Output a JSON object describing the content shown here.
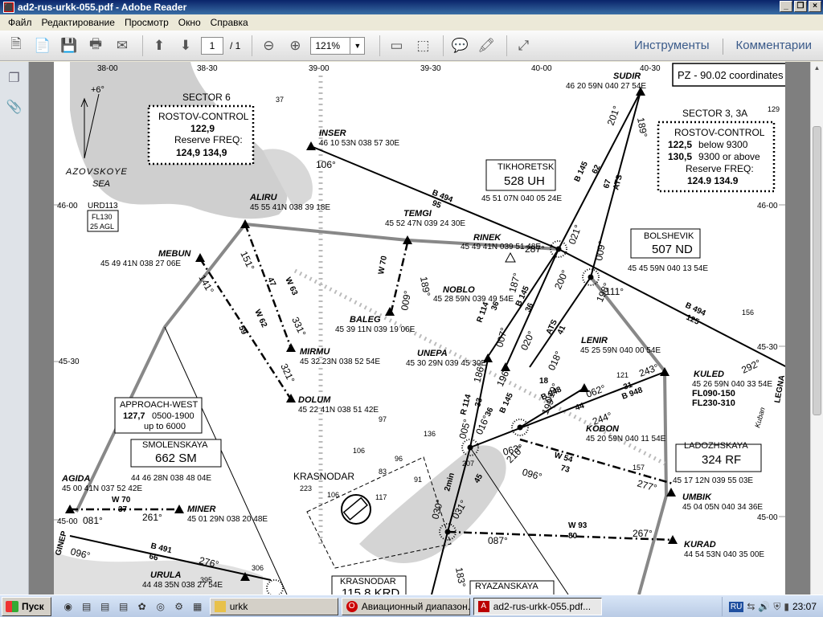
{
  "window": {
    "title": "ad2-rus-urkk-055.pdf - Adobe Reader",
    "app_icon": "pdf-icon"
  },
  "menu": [
    "Файл",
    "Редактирование",
    "Просмотр",
    "Окно",
    "Справка"
  ],
  "toolbar": {
    "page_current": "1",
    "page_total": "/ 1",
    "zoom": "121%",
    "tools_link": "Инструменты",
    "comments_link": "Комментарии"
  },
  "chart": {
    "header_box": "PZ - 90.02 coordinates",
    "sector6": {
      "title": "SECTOR 6",
      "unit": "ROSTOV-CONTROL",
      "freq": "122,9",
      "reserve": "Reserve FREQ:",
      "reserve_freqs": "124,9 134,9"
    },
    "sector3": {
      "title": "SECTOR 3, 3A",
      "unit": "ROSTOV-CONTROL",
      "freq1": "122,5",
      "freq1_note": "below 9300",
      "freq2": "130,5",
      "freq2_note": "9300 or above",
      "reserve": "Reserve FREQ:",
      "reserve_freqs": "124.9 134.9"
    },
    "sea_label_1": "AZOVSKOYE",
    "sea_label_2": "SEA",
    "variation": "+6°",
    "city": "KRASNODAR",
    "lat_labels": [
      "46-00",
      "45-30",
      "45-00",
      "46-00",
      "45-30",
      "45-00"
    ],
    "lon_labels": [
      "38-00",
      "38-30",
      "39-00",
      "39-30",
      "40-00",
      "40-30"
    ],
    "urd": "URD113",
    "urd_limits_1": "FL130",
    "urd_limits_2": "25 AGL",
    "points": [
      {
        "name": "SUDIR",
        "coords": "46 20 59N  040 27 54E"
      },
      {
        "name": "INSER",
        "coords": "46 10 53N  038 57 30E"
      },
      {
        "name": "ALIRU",
        "coords": "45 55 41N 038 39 18E"
      },
      {
        "name": "TEMGI",
        "coords": "45 52 47N 039 24 30E"
      },
      {
        "name": "MEBUN",
        "coords": "45 49 41N 038 27 06E"
      },
      {
        "name": "RINEK",
        "coords": "45 49 41N 039 51 48E"
      },
      {
        "name": "NOBLO",
        "coords": "45 28 59N 039 49 54E"
      },
      {
        "name": "BALEG",
        "coords": "45 39 11N 039 19 06E"
      },
      {
        "name": "MIRMU",
        "coords": "45 32 23N 038 52 54E"
      },
      {
        "name": "UNEPA",
        "coords": "45 30 29N 039 45 30E"
      },
      {
        "name": "LENIR",
        "coords": "45 25 59N 040 00 54E"
      },
      {
        "name": "KULED",
        "coords": "45 26 59N 040 33 54E"
      },
      {
        "name": "DOLUM",
        "coords": "45 22 41N 038 51 42E"
      },
      {
        "name": "KOBON",
        "coords": "45 20 59N 040 11 54E"
      },
      {
        "name": "AGIDA",
        "coords": "45 00 41N 037 52 42E"
      },
      {
        "name": "MINER",
        "coords": "45 01 29N 038 20 48E"
      },
      {
        "name": "UMBIK",
        "coords": "45 04 05N 040 34 36E"
      },
      {
        "name": "KURAD",
        "coords": "44 54 53N 040 35 00E"
      },
      {
        "name": "URULA",
        "coords": "44 48 35N 038 27 54E"
      }
    ],
    "navaids": [
      {
        "name": "TIKHORETSK",
        "ident": "528 UH",
        "coords": "45 51 07N 040 05 24E"
      },
      {
        "name": "BOLSHEVIK",
        "ident": "507 ND",
        "coords": "45 45 59N 040 13 54E"
      },
      {
        "name": "SMOLENSKAYA",
        "ident": "662 SM",
        "coords": "44 46 28N 038 48 04E"
      },
      {
        "name": "LADOZHSKAYA",
        "ident": "324 RF",
        "coords": "45 17 12N 039 55 03E"
      },
      {
        "name": "KRASNODAR",
        "ident": "115.8 KRD"
      },
      {
        "name": "RYAZANSKAYA",
        "ident": ""
      }
    ],
    "approach_west": {
      "title": "APPROACH-WEST",
      "freq": "127,7",
      "hours": "0500-1900",
      "limit": "up to 6000"
    },
    "kuled_levels": [
      "FL090-150",
      "FL230-310"
    ],
    "routes": {
      "b494": "B 494",
      "b494_dist": "95",
      "b494_2": "B 494",
      "b494_2_dist": "125",
      "w70": "W 70",
      "w63": "W 63",
      "w63_dist": "47",
      "w62": "W 62",
      "w62_dist": "59",
      "b145a": "B 145",
      "b145a_dist": "62",
      "ats1": "ATS",
      "ats1_dist": "67",
      "b145b": "B 145",
      "b145b_dist": "36",
      "r114a": "R 114",
      "r114a_dist": "36",
      "ats2": "ATS",
      "ats2_dist": "41",
      "b948": "B 948",
      "b948_dist": "31",
      "b948_2": "B 948",
      "b948_2_dist": "44",
      "w54": "W 54",
      "w54_dist": "73",
      "w93": "W 93",
      "w93_dist": "80",
      "w70b": "W 70",
      "w70b_dist": "37",
      "b491": "B 491",
      "b491_dist": "66",
      "r114b": "R 114",
      "r114b_dist": "33",
      "b145c": "B 145",
      "b145c_dist": "36",
      "d45": "45",
      "d18": "18",
      "d2min": "2min",
      "legna": "LEGNA",
      "ginep": "GINEP"
    },
    "bearings": [
      "106°",
      "201°",
      "189°",
      "021°",
      "287°",
      "009°",
      "111°",
      "292°",
      "151°",
      "331°",
      "141°",
      "321°",
      "009°",
      "189°",
      "187°",
      "007°",
      "200°",
      "198°",
      "018°",
      "020°",
      "186°",
      "196°",
      "199°",
      "019°",
      "062°",
      "243°",
      "244°",
      "063°",
      "210°",
      "096°",
      "277°",
      "005°",
      "016°",
      "030°",
      "031°",
      "087°",
      "267°",
      "183°",
      "081°",
      "261°",
      "096°",
      "276°"
    ],
    "spot_heights": [
      "37",
      "129",
      "156",
      "121",
      "97",
      "106",
      "136",
      "83",
      "96",
      "91",
      "223",
      "106",
      "117",
      "157",
      "207",
      "306",
      "395"
    ],
    "place_label_kuban": "Kuban"
  },
  "taskbar": {
    "start": "Пуск",
    "tasks": [
      {
        "label": "urkk",
        "icon": "folder-icon"
      },
      {
        "label": "Авиационный диапазон...",
        "icon": "opera-icon"
      },
      {
        "label": "ad2-rus-urkk-055.pdf...",
        "icon": "pdf-icon",
        "active": true
      }
    ],
    "lang": "RU",
    "clock": "23:07"
  }
}
